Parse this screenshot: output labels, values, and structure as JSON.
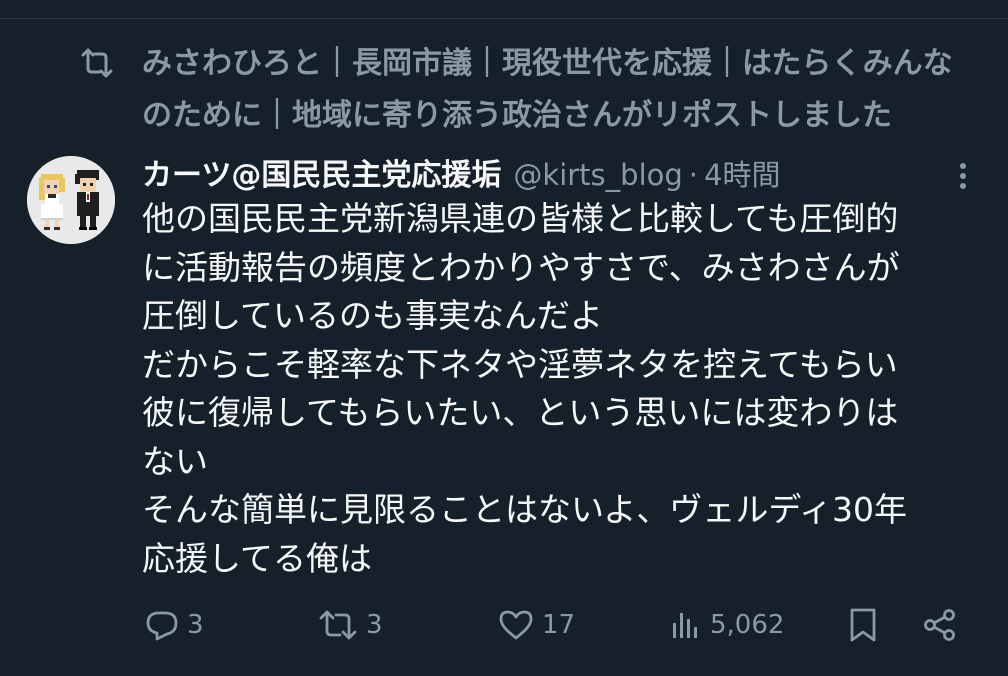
{
  "social_context": {
    "lines": [
      "みさわひろと｜長岡市議｜現役世代を応援｜はたらくみんな",
      "のために｜地域に寄り添う政治さんがリポストしました"
    ]
  },
  "tweet": {
    "display_name": "カーツ@国民民主党応援垢",
    "handle": "@kirts_blog",
    "separator": "·",
    "timestamp": "4時間",
    "body_lines": [
      "他の国民民主党新潟県連の皆様と比較しても圧倒的",
      "に活動報告の頻度とわかりやすさで、みさわさんが",
      "圧倒しているのも事実なんだよ",
      "だからこそ軽率な下ネタや淫夢ネタを控えてもらい",
      "彼に復帰してもらいたい、という思いには変わりは",
      "ない",
      "そんな簡単に見限ることはないよ、ヴェルディ30年",
      "応援してる俺は"
    ]
  },
  "actions": {
    "replies": "3",
    "reposts": "3",
    "likes": "17",
    "views": "5,062"
  },
  "icons": {
    "retweet": "retweet-icon",
    "more": "more-dots-icon",
    "reply": "reply-icon",
    "like": "heart-icon",
    "views": "views-chart-icon",
    "bookmark": "bookmark-icon",
    "share": "share-icon"
  },
  "colors": {
    "background": "#15202b",
    "text_primary": "#f7f9f9",
    "text_secondary": "#8b98a5"
  }
}
